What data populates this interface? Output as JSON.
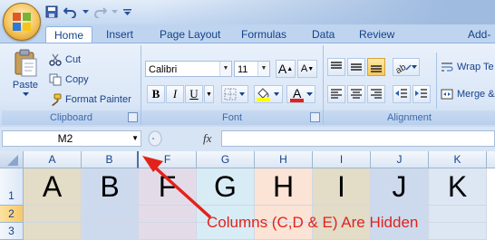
{
  "tabs": [
    "Home",
    "Insert",
    "Page Layout",
    "Formulas",
    "Data",
    "Review",
    "Add-In"
  ],
  "active_tab": "Home",
  "clipboard": {
    "paste": "Paste",
    "cut": "Cut",
    "copy": "Copy",
    "format_painter": "Format Painter",
    "label": "Clipboard"
  },
  "font": {
    "family": "Calibri",
    "size": "11",
    "bold": "B",
    "italic": "I",
    "underline": "U",
    "grow": "A",
    "shrink": "A",
    "font_color_glyph": "A",
    "label": "Font",
    "font_color": "#e2231a",
    "fill_color": "#ffff00"
  },
  "alignment": {
    "wrap_text": "Wrap Te",
    "merge": "Merge &",
    "label": "Alignment"
  },
  "formula_bar": {
    "name_box": "M2",
    "fx": "fx",
    "value": ""
  },
  "columns": [
    {
      "letter": "A",
      "value": "A",
      "color": "#e3dcc6"
    },
    {
      "letter": "B",
      "value": "B",
      "color": "#cddaee"
    },
    {
      "letter": "F",
      "value": "F",
      "color": "#e4dbe9"
    },
    {
      "letter": "G",
      "value": "G",
      "color": "#d8ecf5"
    },
    {
      "letter": "H",
      "value": "H",
      "color": "#fbe3d5"
    },
    {
      "letter": "I",
      "value": "I",
      "color": "#e3dcc6"
    },
    {
      "letter": "J",
      "value": "J",
      "color": "#cddaee"
    },
    {
      "letter": "K",
      "value": "K",
      "color": "#dde7f3"
    }
  ],
  "rows": [
    "1",
    "2",
    "3"
  ],
  "selected_row": "2",
  "annotation": {
    "text": "Columns (C,D & E) Are Hidden",
    "color": "#e2231a"
  }
}
